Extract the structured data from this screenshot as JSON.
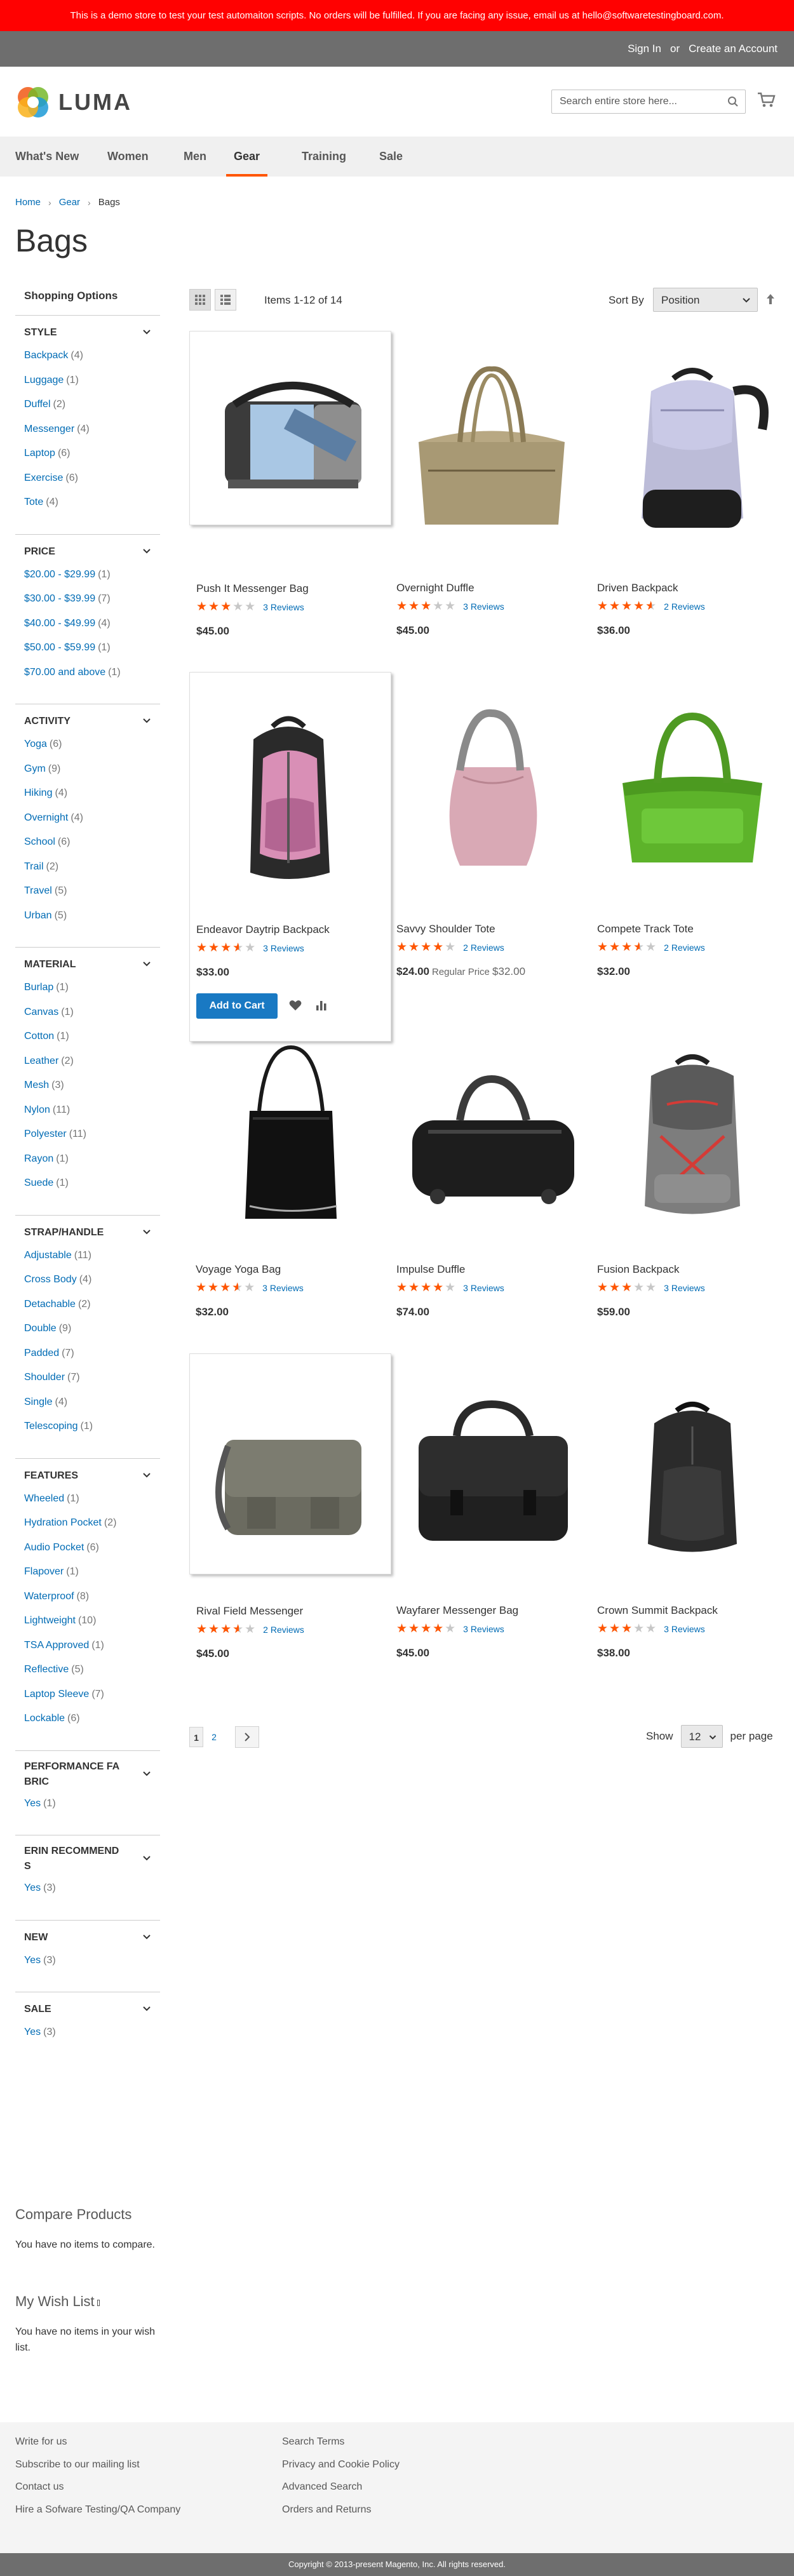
{
  "demo_notice": "This is a demo store to test your test automaiton scripts. No orders will be fulfilled. If you are facing any issue, email us at hello@softwaretestingboard.com.",
  "header": {
    "sign_in": "Sign In",
    "or": "or",
    "create_account": "Create an Account",
    "logo_text": "LUMA",
    "search_placeholder": "Search entire store here..."
  },
  "nav": [
    "What's New",
    "Women",
    "Men",
    "Gear",
    "Training",
    "Sale"
  ],
  "breadcrumbs": {
    "home": "Home",
    "gear": "Gear",
    "current": "Bags"
  },
  "page_title": "Bags",
  "shopping_options": "Shopping Options",
  "filters": [
    {
      "title": "Style",
      "items": [
        {
          "label": "Backpack",
          "count": "4"
        },
        {
          "label": "Luggage",
          "count": "1"
        },
        {
          "label": "Duffel",
          "count": "2"
        },
        {
          "label": "Messenger",
          "count": "4"
        },
        {
          "label": "Laptop",
          "count": "6"
        },
        {
          "label": "Exercise",
          "count": "6"
        },
        {
          "label": "Tote",
          "count": "4"
        }
      ]
    },
    {
      "title": "Price",
      "items": [
        {
          "label": "$20.00 - $29.99",
          "count": "1"
        },
        {
          "label": "$30.00 - $39.99",
          "count": "7"
        },
        {
          "label": "$40.00 - $49.99",
          "count": "4"
        },
        {
          "label": "$50.00 - $59.99",
          "count": "1"
        },
        {
          "label": "$70.00 and above",
          "count": "1"
        }
      ]
    },
    {
      "title": "Activity",
      "items": [
        {
          "label": "Yoga",
          "count": "6"
        },
        {
          "label": "Gym",
          "count": "9"
        },
        {
          "label": "Hiking",
          "count": "4"
        },
        {
          "label": "Overnight",
          "count": "4"
        },
        {
          "label": "School",
          "count": "6"
        },
        {
          "label": "Trail",
          "count": "2"
        },
        {
          "label": "Travel",
          "count": "5"
        },
        {
          "label": "Urban",
          "count": "5"
        }
      ]
    },
    {
      "title": "Material",
      "items": [
        {
          "label": "Burlap",
          "count": "1"
        },
        {
          "label": "Canvas",
          "count": "1"
        },
        {
          "label": "Cotton",
          "count": "1"
        },
        {
          "label": "Leather",
          "count": "2"
        },
        {
          "label": "Mesh",
          "count": "3"
        },
        {
          "label": "Nylon",
          "count": "11"
        },
        {
          "label": "Polyester",
          "count": "11"
        },
        {
          "label": "Rayon",
          "count": "1"
        },
        {
          "label": "Suede",
          "count": "1"
        }
      ]
    },
    {
      "title": "Strap/Handle",
      "items": [
        {
          "label": "Adjustable",
          "count": "11"
        },
        {
          "label": "Cross Body",
          "count": "4"
        },
        {
          "label": "Detachable",
          "count": "2"
        },
        {
          "label": "Double",
          "count": "9"
        },
        {
          "label": "Padded",
          "count": "7"
        },
        {
          "label": "Shoulder",
          "count": "7"
        },
        {
          "label": "Single",
          "count": "4"
        },
        {
          "label": "Telescoping",
          "count": "1"
        }
      ]
    },
    {
      "title": "Features",
      "items": [
        {
          "label": "Wheeled",
          "count": "1"
        },
        {
          "label": "Hydration Pocket",
          "count": "2"
        },
        {
          "label": "Audio Pocket",
          "count": "6"
        },
        {
          "label": "Flapover",
          "count": "1"
        },
        {
          "label": "Waterproof",
          "count": "8"
        },
        {
          "label": "Lightweight",
          "count": "10"
        },
        {
          "label": "TSA Approved",
          "count": "1"
        },
        {
          "label": "Reflective",
          "count": "5"
        },
        {
          "label": "Laptop Sleeve",
          "count": "7"
        },
        {
          "label": "Lockable",
          "count": "6"
        }
      ]
    },
    {
      "title": "Performance Fa",
      "title2": "bric",
      "items": [
        {
          "label": "Yes",
          "count": "1"
        }
      ]
    },
    {
      "title": "Erin Recommend",
      "title2": "s",
      "items": [
        {
          "label": "Yes",
          "count": "3"
        }
      ]
    },
    {
      "title": "New",
      "items": [
        {
          "label": "Yes",
          "count": "3"
        }
      ]
    },
    {
      "title": "Sale",
      "items": [
        {
          "label": "Yes",
          "count": "3"
        }
      ]
    }
  ],
  "compare": {
    "title": "Compare Products",
    "text": "You have no items to compare."
  },
  "wishlist": {
    "title": "My Wish List",
    "text": "You have no items in your wish list."
  },
  "toolbar": {
    "amount": "Items 1-12 of 14",
    "sort_label": "Sort By",
    "sort_value": "Position"
  },
  "products": [
    {
      "name": "Push It Messenger Bag",
      "rating": 0.6,
      "reviews": "3 Reviews",
      "price": "$45.00"
    },
    {
      "name": "Overnight Duffle",
      "rating": 0.6,
      "reviews": "3 Reviews",
      "price": "$45.00"
    },
    {
      "name": "Driven Backpack",
      "rating": 0.9,
      "reviews": "2 Reviews",
      "price": "$36.00"
    },
    {
      "name": "Endeavor Daytrip Backpack",
      "rating": 0.7,
      "reviews": "3 Reviews",
      "price": "$33.00",
      "add_to_cart": "Add to Cart"
    },
    {
      "name": "Savvy Shoulder Tote",
      "rating": 0.8,
      "reviews": "2 Reviews",
      "price": "$24.00",
      "regular_label": "Regular Price",
      "regular_price": "$32.00"
    },
    {
      "name": "Compete Track Tote",
      "rating": 0.7,
      "reviews": "2 Reviews",
      "price": "$32.00"
    },
    {
      "name": "Voyage Yoga Bag",
      "rating": 0.7,
      "reviews": "3 Reviews",
      "price": "$32.00"
    },
    {
      "name": "Impulse Duffle",
      "rating": 0.8,
      "reviews": "3 Reviews",
      "price": "$74.00"
    },
    {
      "name": "Fusion Backpack",
      "rating": 0.6,
      "reviews": "3 Reviews",
      "price": "$59.00"
    },
    {
      "name": "Rival Field Messenger",
      "rating": 0.7,
      "reviews": "2 Reviews",
      "price": "$45.00"
    },
    {
      "name": "Wayfarer Messenger Bag",
      "rating": 0.8,
      "reviews": "3 Reviews",
      "price": "$45.00"
    },
    {
      "name": "Crown Summit Backpack",
      "rating": 0.6,
      "reviews": "3 Reviews",
      "price": "$38.00"
    }
  ],
  "pager": {
    "current": "1",
    "next_page": "2",
    "show_label": "Show",
    "limit": "12",
    "per_page": "per page"
  },
  "footer": {
    "col1": [
      "Write for us",
      "Subscribe to our mailing list",
      "Contact us",
      "Hire a Sofware Testing/QA Company"
    ],
    "col2": [
      "Search Terms",
      "Privacy and Cookie Policy",
      "Advanced Search",
      "Orders and Returns"
    ]
  },
  "copyright": "Copyright © 2013-present Magento, Inc. All rights reserved.",
  "colors": {
    "accent": "#ff5501",
    "link": "#006bb4",
    "button": "#1979c3",
    "demo_bar": "#ff0101"
  }
}
